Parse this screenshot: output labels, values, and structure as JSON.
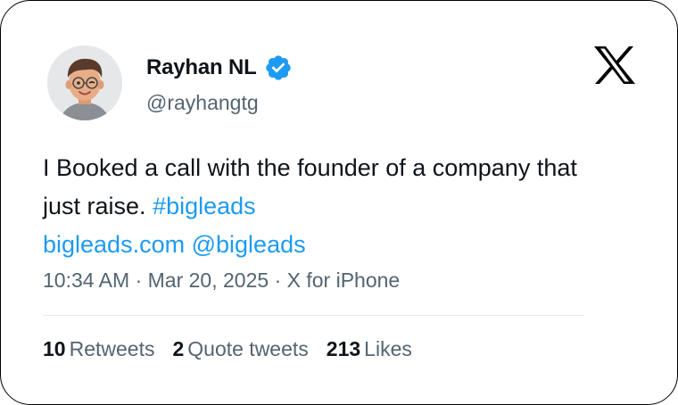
{
  "author": {
    "display_name": "Rayhan NL",
    "handle": "@rayhangtg",
    "verified": true
  },
  "tweet": {
    "text_plain": "I Booked a call with the founder of a company that just raise.",
    "hashtag": "#bigleads",
    "link": "bigleads.com",
    "mention": "@bigleads"
  },
  "meta": {
    "time": "10:34 AM",
    "date": "Mar 20, 2025",
    "source": "X for iPhone"
  },
  "stats": [
    {
      "count": "10",
      "label": "Retweets"
    },
    {
      "count": "2",
      "label": "Quote tweets"
    },
    {
      "count": "213",
      "label": "Likes"
    }
  ],
  "colors": {
    "link": "#1d9bf0",
    "secondary_text": "#536471",
    "primary_text": "#0f1419",
    "divider": "#e7e9ea",
    "avatar_bg": "#e6e7e9"
  },
  "icons": {
    "brand": "x-logo-icon",
    "badge": "verified-badge-icon",
    "avatar": "memoji-avatar"
  }
}
